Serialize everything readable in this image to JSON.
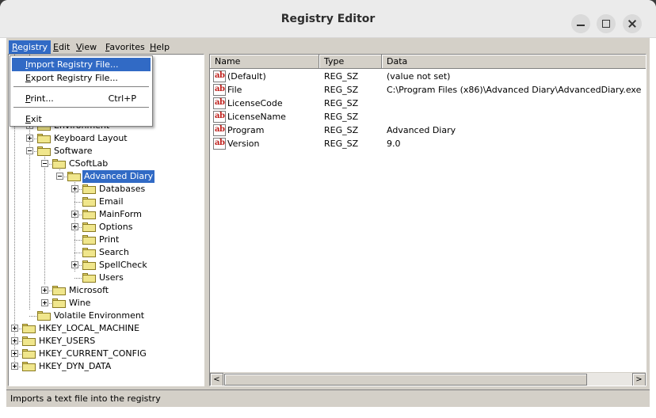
{
  "window": {
    "title": "Registry Editor"
  },
  "menubar": [
    {
      "label": "Registry",
      "accel": "R",
      "rest": "egistry",
      "active": true
    },
    {
      "label": "Edit",
      "accel": "E",
      "rest": "dit"
    },
    {
      "label": "View",
      "accel": "V",
      "rest": "iew"
    },
    {
      "label": "Favorites",
      "accel": "F",
      "rest": "avorites"
    },
    {
      "label": "Help",
      "accel": "H",
      "rest": "elp"
    }
  ],
  "registry_menu": {
    "items": [
      {
        "label": "Import Registry File...",
        "accel": "I",
        "rest": "mport Registry File...",
        "shortcut": "",
        "highlighted": true
      },
      {
        "label": "Export Registry File...",
        "accel": "E",
        "rest": "xport Registry File...",
        "shortcut": ""
      },
      {
        "label": "Print...",
        "accel": "P",
        "rest": "rint...",
        "shortcut": "Ctrl+P"
      },
      {
        "label": "Exit",
        "accel": "E",
        "rest": "xit",
        "shortcut": ""
      }
    ]
  },
  "tree": {
    "nodes": [
      {
        "label": "Environment",
        "depth": 2,
        "expander": "plus"
      },
      {
        "label": "Keyboard Layout",
        "depth": 2,
        "expander": "plus"
      },
      {
        "label": "Software",
        "depth": 2,
        "expander": "minus"
      },
      {
        "label": "CSoftLab",
        "depth": 3,
        "expander": "minus"
      },
      {
        "label": "Advanced Diary",
        "depth": 4,
        "expander": "minus",
        "selected": true
      },
      {
        "label": "Databases",
        "depth": 5,
        "expander": "plus"
      },
      {
        "label": "Email",
        "depth": 5,
        "expander": "none"
      },
      {
        "label": "MainForm",
        "depth": 5,
        "expander": "plus"
      },
      {
        "label": "Options",
        "depth": 5,
        "expander": "plus"
      },
      {
        "label": "Print",
        "depth": 5,
        "expander": "none"
      },
      {
        "label": "Search",
        "depth": 5,
        "expander": "none"
      },
      {
        "label": "SpellCheck",
        "depth": 5,
        "expander": "plus"
      },
      {
        "label": "Users",
        "depth": 5,
        "expander": "none"
      },
      {
        "label": "Microsoft",
        "depth": 3,
        "expander": "plus"
      },
      {
        "label": "Wine",
        "depth": 3,
        "expander": "plus"
      },
      {
        "label": "Volatile Environment",
        "depth": 2,
        "expander": "none"
      },
      {
        "label": "HKEY_LOCAL_MACHINE",
        "depth": 1,
        "expander": "plus"
      },
      {
        "label": "HKEY_USERS",
        "depth": 1,
        "expander": "plus"
      },
      {
        "label": "HKEY_CURRENT_CONFIG",
        "depth": 1,
        "expander": "plus"
      },
      {
        "label": "HKEY_DYN_DATA",
        "depth": 1,
        "expander": "plus"
      }
    ]
  },
  "list": {
    "columns": [
      "Name",
      "Type",
      "Data"
    ],
    "rows": [
      {
        "name": "(Default)",
        "type": "REG_SZ",
        "data": "(value not set)"
      },
      {
        "name": "File",
        "type": "REG_SZ",
        "data": "C:\\Program Files (x86)\\Advanced Diary\\AdvancedDiary.exe"
      },
      {
        "name": "LicenseCode",
        "type": "REG_SZ",
        "data": ""
      },
      {
        "name": "LicenseName",
        "type": "REG_SZ",
        "data": ""
      },
      {
        "name": "Program",
        "type": "REG_SZ",
        "data": "Advanced Diary"
      },
      {
        "name": "Version",
        "type": "REG_SZ",
        "data": "9.0"
      }
    ],
    "icon_text": "ab"
  },
  "scrollbar": {
    "left_arrow": "<",
    "right_arrow": ">"
  },
  "statusbar": {
    "text": "Imports a text file into the registry"
  }
}
